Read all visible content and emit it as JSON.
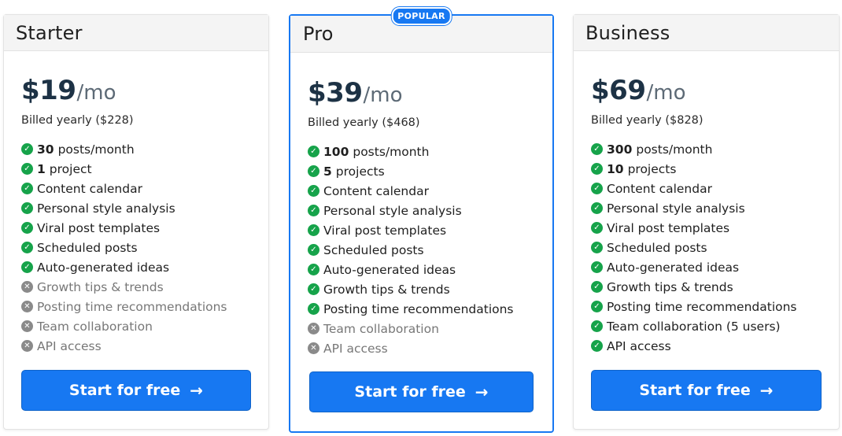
{
  "plans": {
    "starter": {
      "name": "Starter",
      "price": "$19",
      "period": "/mo",
      "billed": "Billed yearly ($228)",
      "features": [
        {
          "bold": "30",
          "text": "posts/month",
          "included": true
        },
        {
          "bold": "1",
          "text": "project",
          "included": true
        },
        {
          "bold": "",
          "text": "Content calendar",
          "included": true
        },
        {
          "bold": "",
          "text": "Personal style analysis",
          "included": true
        },
        {
          "bold": "",
          "text": "Viral post templates",
          "included": true
        },
        {
          "bold": "",
          "text": "Scheduled posts",
          "included": true
        },
        {
          "bold": "",
          "text": "Auto-generated ideas",
          "included": true
        },
        {
          "bold": "",
          "text": "Growth tips & trends",
          "included": false
        },
        {
          "bold": "",
          "text": "Posting time recommendations",
          "included": false
        },
        {
          "bold": "",
          "text": "Team collaboration",
          "included": false
        },
        {
          "bold": "",
          "text": "API access",
          "included": false
        }
      ],
      "cta": "Start for free"
    },
    "pro": {
      "name": "Pro",
      "badge": "POPULAR",
      "price": "$39",
      "period": "/mo",
      "billed": "Billed yearly ($468)",
      "features": [
        {
          "bold": "100",
          "text": "posts/month",
          "included": true
        },
        {
          "bold": "5",
          "text": "projects",
          "included": true
        },
        {
          "bold": "",
          "text": "Content calendar",
          "included": true
        },
        {
          "bold": "",
          "text": "Personal style analysis",
          "included": true
        },
        {
          "bold": "",
          "text": "Viral post templates",
          "included": true
        },
        {
          "bold": "",
          "text": "Scheduled posts",
          "included": true
        },
        {
          "bold": "",
          "text": "Auto-generated ideas",
          "included": true
        },
        {
          "bold": "",
          "text": "Growth tips & trends",
          "included": true
        },
        {
          "bold": "",
          "text": "Posting time recommendations",
          "included": true
        },
        {
          "bold": "",
          "text": "Team collaboration",
          "included": false
        },
        {
          "bold": "",
          "text": "API access",
          "included": false
        }
      ],
      "cta": "Start for free"
    },
    "business": {
      "name": "Business",
      "price": "$69",
      "period": "/mo",
      "billed": "Billed yearly ($828)",
      "features": [
        {
          "bold": "300",
          "text": "posts/month",
          "included": true
        },
        {
          "bold": "10",
          "text": "projects",
          "included": true
        },
        {
          "bold": "",
          "text": "Content calendar",
          "included": true
        },
        {
          "bold": "",
          "text": "Personal style analysis",
          "included": true
        },
        {
          "bold": "",
          "text": "Viral post templates",
          "included": true
        },
        {
          "bold": "",
          "text": "Scheduled posts",
          "included": true
        },
        {
          "bold": "",
          "text": "Auto-generated ideas",
          "included": true
        },
        {
          "bold": "",
          "text": "Growth tips & trends",
          "included": true
        },
        {
          "bold": "",
          "text": "Posting time recommendations",
          "included": true
        },
        {
          "bold": "",
          "text": "Team collaboration (5 users)",
          "included": true
        },
        {
          "bold": "",
          "text": "API access",
          "included": true
        }
      ],
      "cta": "Start for free"
    }
  },
  "icons": {
    "included": "check-circle-icon",
    "excluded": "x-circle-icon",
    "cta": "arrow-right-icon"
  },
  "colors": {
    "accent": "#1778f2",
    "check": "#16a34a",
    "excluded": "#8a8a8a",
    "price": "#1d3245"
  }
}
